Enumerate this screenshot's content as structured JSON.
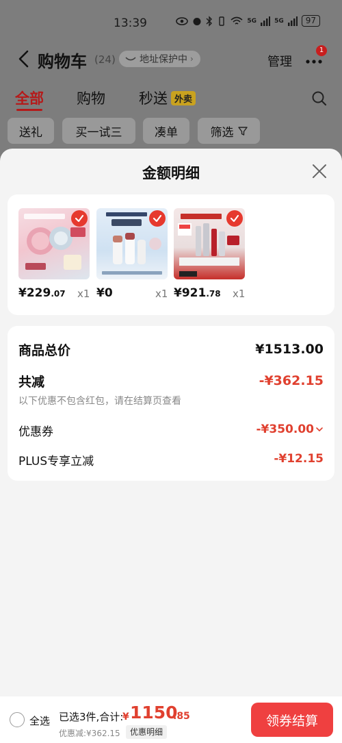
{
  "status_bar": {
    "time": "13:39",
    "network_1": "5G",
    "network_2": "5G",
    "battery": "97"
  },
  "header": {
    "title": "购物车",
    "count": "(24)",
    "address_protect": "地址保护中",
    "manage": "管理",
    "badge": "1"
  },
  "tabs": {
    "all": "全部",
    "shopping": "购物",
    "flash": "秒送",
    "takeout_tag": "外卖"
  },
  "filters": {
    "gift": "送礼",
    "try": "买一试三",
    "bundle": "凑单",
    "filter": "筛选"
  },
  "sheet": {
    "title": "金额明细",
    "products": [
      {
        "price_int": "¥229",
        "price_dec": ".07",
        "qty": "x1",
        "theme_color": "#e8a9b6"
      },
      {
        "price_int": "¥0",
        "price_dec": "",
        "qty": "x1",
        "theme_color": "#a9cde8"
      },
      {
        "price_int": "¥921",
        "price_dec": ".78",
        "qty": "x1",
        "theme_color": "#c9302c"
      }
    ],
    "summary": {
      "total_label": "商品总价",
      "total_value": "¥1513.00",
      "reduce_label": "共减",
      "reduce_value": "-¥362.15",
      "note": "以下优惠不包含红包，请在结算页查看",
      "coupon_label": "优惠券",
      "coupon_value": "-¥350.00",
      "plus_label": "PLUS专享立减",
      "plus_value": "-¥12.15"
    }
  },
  "footer": {
    "select_all": "全选",
    "selected_text": "已选3件,合计:",
    "total_symbol": "¥",
    "total_int": "1150",
    "total_dec": ".85",
    "discount_text": "优惠减:¥362.15",
    "detail_tag": "优惠明细",
    "checkout": "领券结算"
  },
  "colors": {
    "accent_red": "#e0402f",
    "button_red": "#ef4040",
    "overlay": "#7d7d7d"
  }
}
